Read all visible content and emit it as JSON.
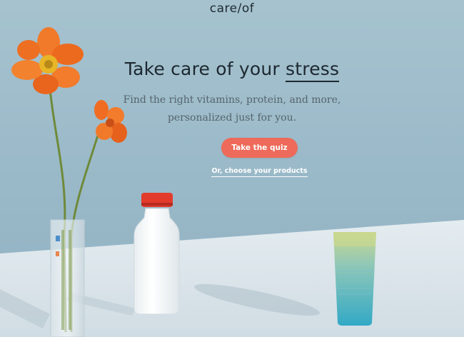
{
  "header": {
    "logo_text": "care/of"
  },
  "hero": {
    "title_prefix": "Take care of your ",
    "title_highlight": "stress",
    "subtitle_line1": "Find the right vitamins, protein, and more,",
    "subtitle_line2": "personalized just for you."
  },
  "cta": {
    "quiz_label": "Take the quiz",
    "products_link": "Or, choose your products"
  },
  "colors": {
    "wall": "#9bb9c8",
    "table": "#dfe8ee",
    "accent": "#ee6a5a",
    "text_dark": "#1d2830"
  },
  "illustration": {
    "items": [
      "flower-icon",
      "vase-icon",
      "milk-bottle-icon",
      "water-glass-icon"
    ]
  }
}
